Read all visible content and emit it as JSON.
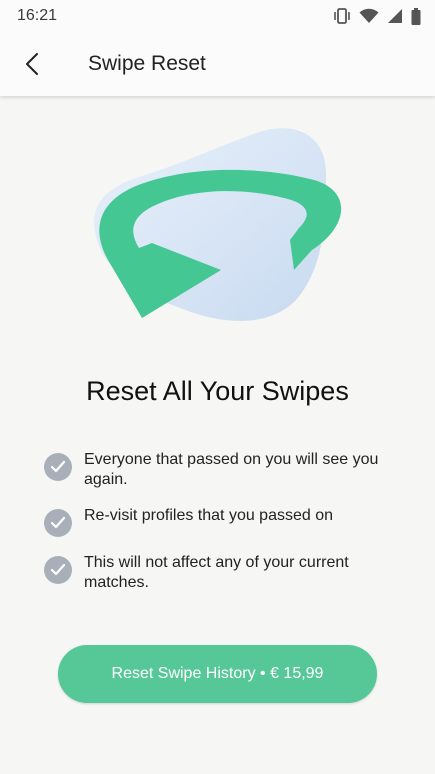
{
  "status_bar": {
    "time": "16:21",
    "icons": [
      "vibrate-icon",
      "wifi-icon",
      "signal-icon",
      "battery-icon"
    ]
  },
  "app_bar": {
    "back_icon": "back-arrow-icon",
    "title": "Swipe Reset"
  },
  "illustration": {
    "icon": "refresh-arrow-icon",
    "colors": {
      "arrow": "#45c794",
      "blob": "#d6e4f5"
    }
  },
  "headline": "Reset All Your Swipes",
  "features": [
    {
      "icon": "check-icon",
      "text": "Everyone that passed on you will see you again."
    },
    {
      "icon": "check-icon",
      "text": "Re-visit profiles that you passed on"
    },
    {
      "icon": "check-icon",
      "text": "This will not affect any of your current matches."
    }
  ],
  "cta": {
    "label": "Reset Swipe History • € 15,99",
    "color": "#56c897"
  }
}
